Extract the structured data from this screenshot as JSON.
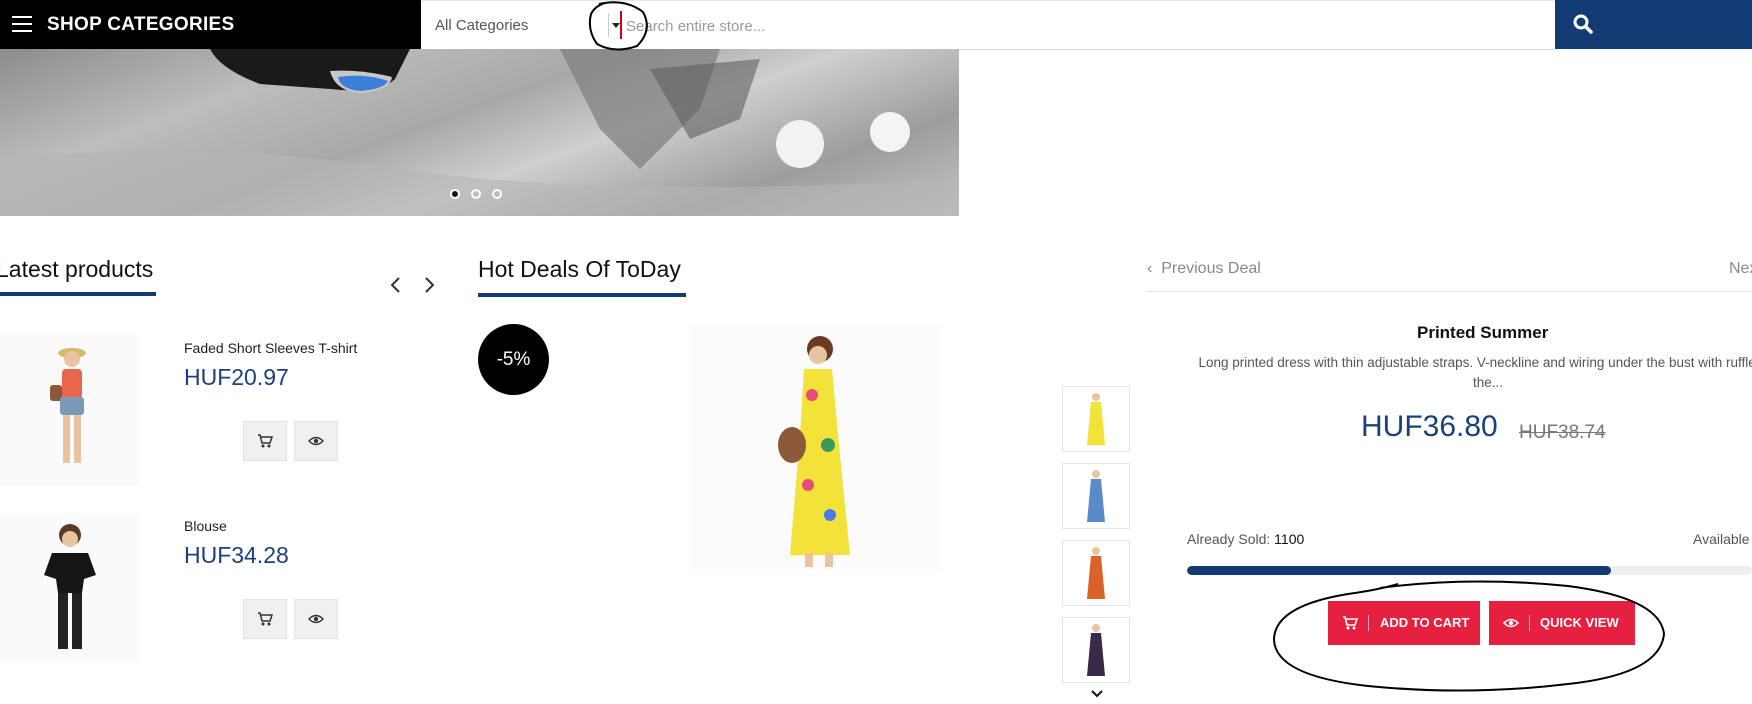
{
  "header": {
    "shop_categories_label": "SHOP CATEGORIES",
    "category_select_value": "All Categories",
    "search_placeholder": "Search entire store..."
  },
  "banner": {
    "slides": 3,
    "active_slide": 1
  },
  "latest_products": {
    "title": "Latest products",
    "items": [
      {
        "name": "Faded Short Sleeves T-shirt",
        "price": "HUF20.97"
      },
      {
        "name": "Blouse",
        "price": "HUF34.28"
      }
    ]
  },
  "hot_deals": {
    "title": "Hot Deals Of ToDay",
    "discount_badge": "-5%"
  },
  "deal": {
    "prev_label": "Previous Deal",
    "next_label": "Next",
    "title": "Printed Summer",
    "description": "Long printed dress with thin adjustable straps. V-neckline and wiring under the bust with ruffles at the...",
    "price": "HUF36.80",
    "old_price": "HUF38.74",
    "sold_label": "Already Sold:",
    "sold_value": "1100",
    "available_label": "Available",
    "progress_fraction": 0.75,
    "add_to_cart_label": "ADD TO CART",
    "quick_view_label": "QUICK VIEW"
  },
  "colors": {
    "brand_navy": "#133b73",
    "cta_red": "#e5213f",
    "price_blue": "#1d3f7a"
  }
}
